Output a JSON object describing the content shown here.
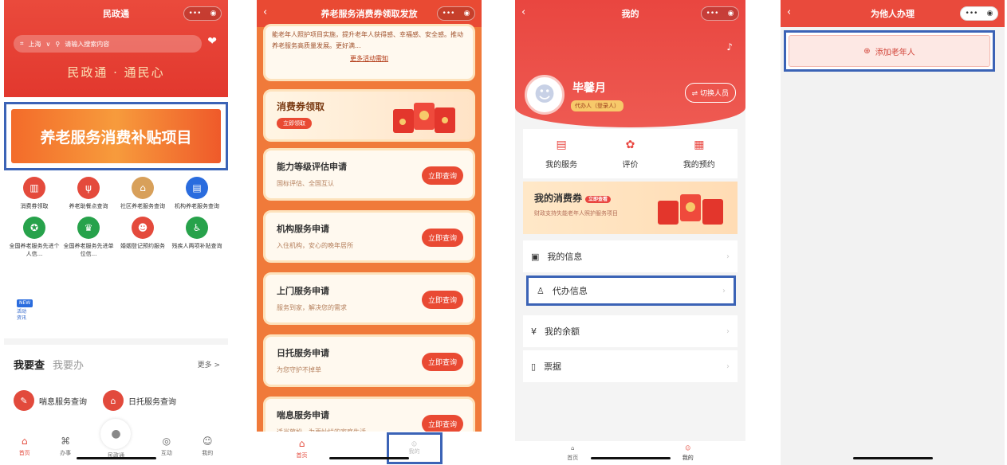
{
  "colors": {
    "primary": "#e94a3c",
    "highlight": "#3b63b6",
    "orange": "#f07a3a"
  },
  "p1": {
    "title": "民政通",
    "city": "上海",
    "search_placeholder": "请输入搜索内容",
    "slogan": "民政通 · 通民心",
    "banner": "养老服务消费补贴项目",
    "grid": [
      {
        "label": "消费券领取",
        "icon": "coupon-icon",
        "color": "#e44a3c"
      },
      {
        "label": "养老助餐点查询",
        "icon": "fork-knife-icon",
        "color": "#e44a3c"
      },
      {
        "label": "社区养老服务查询",
        "icon": "house-icon",
        "color": "#d8a05a"
      },
      {
        "label": "机构养老服务查询",
        "icon": "building-icon",
        "color": "#2a6cde"
      },
      {
        "label": "全国养老服务先进个人信...",
        "icon": "medal-icon",
        "color": "#27a24b"
      },
      {
        "label": "全国养老服务先进单位信...",
        "icon": "trophy-icon",
        "color": "#27a24b"
      },
      {
        "label": "婚姻登记预约服务",
        "icon": "couple-icon",
        "color": "#e44a3c"
      },
      {
        "label": "残疾人两项补贴查询",
        "icon": "wheelchair-icon",
        "color": "#27a24b"
      }
    ],
    "news_badge": "NEW",
    "news_label_1": "活动",
    "news_label_2": "资讯",
    "tab_active": "我要查",
    "tab_other": "我要办",
    "more": "更多 >",
    "quick": [
      {
        "label": "喘息服务查询"
      },
      {
        "label": "日托服务查询"
      }
    ],
    "tabbar": [
      {
        "label": "首页"
      },
      {
        "label": "办事"
      },
      {
        "label": "民政通"
      },
      {
        "label": "互动"
      },
      {
        "label": "我的"
      }
    ]
  },
  "p2": {
    "title": "养老服务消费券领取发放",
    "intro": "能老年人照护项目实施，提升老年人获得感、幸福感、安全感。推动养老服务高质量发展。更好满...",
    "intro_link": "更多活动需知",
    "voucher_title": "消费券领取",
    "voucher_btn": "立即领取",
    "services": [
      {
        "title": "能力等级评估申请",
        "sub": "国标评估、全国互认",
        "btn": "立即查询"
      },
      {
        "title": "机构服务申请",
        "sub": "入住机构，安心的晚年居所",
        "btn": "立即查询"
      },
      {
        "title": "上门服务申请",
        "sub": "服务到家，解决您的需求",
        "btn": "立即查询"
      },
      {
        "title": "日托服务申请",
        "sub": "为您守护不掉单",
        "btn": "立即查询"
      },
      {
        "title": "喘息服务申请",
        "sub": "适当放松，为更灿烂的家庭生活",
        "btn": "立即查询"
      }
    ],
    "tabbar": [
      {
        "label": "首页"
      },
      {
        "label": "我的"
      }
    ]
  },
  "p3": {
    "title": "我的",
    "name": "毕馨月",
    "badge": "代办人（登录人）",
    "switch": "⇌ 切换人员",
    "services": [
      {
        "label": "我的服务"
      },
      {
        "label": "评价"
      },
      {
        "label": "我的预约"
      }
    ],
    "coupon_title": "我的消费券",
    "coupon_tag": "立即查看",
    "coupon_sub": "财政支持失能老年人照护服务项目",
    "menu": [
      {
        "label": "我的信息"
      },
      {
        "label": "代办信息"
      },
      {
        "label": "我的余额"
      },
      {
        "label": "票据"
      }
    ],
    "tabbar": [
      {
        "label": "首页"
      },
      {
        "label": "我的"
      }
    ]
  },
  "p4": {
    "title": "为他人办理",
    "add_label": "添加老年人"
  }
}
